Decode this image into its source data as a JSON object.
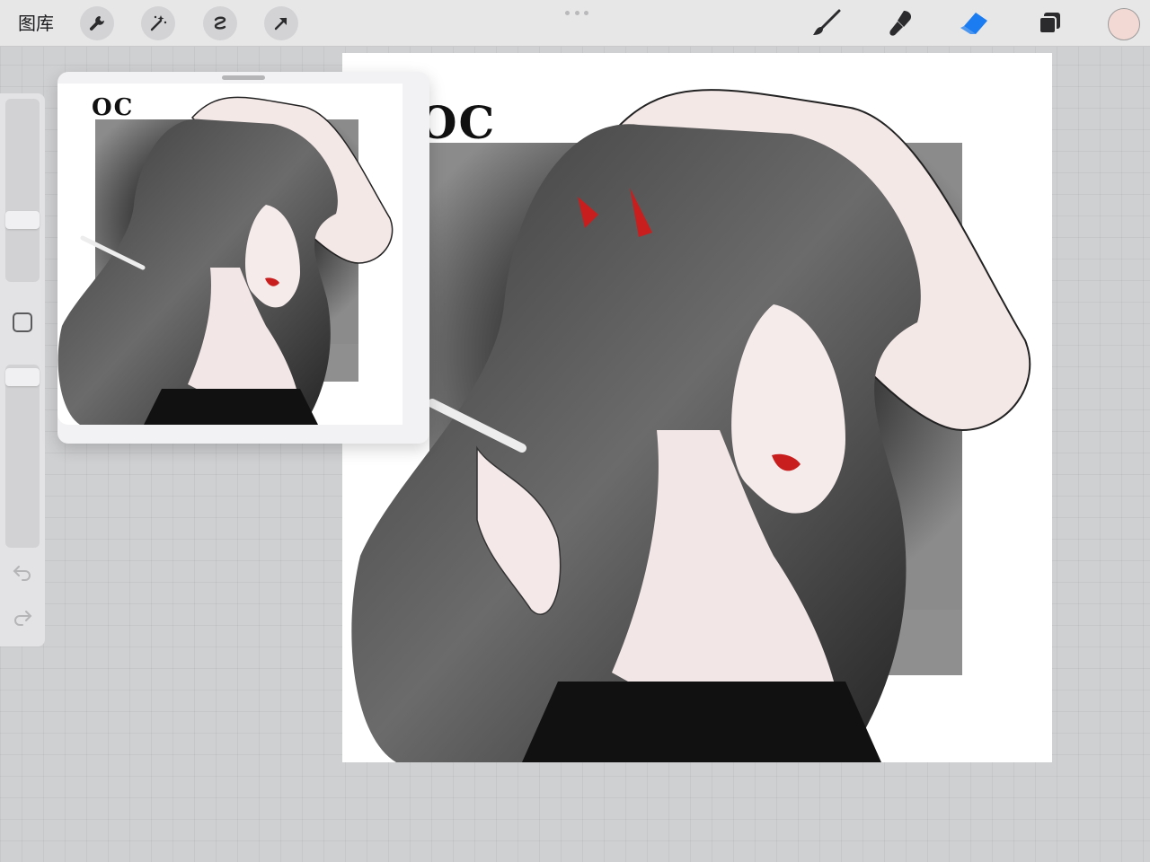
{
  "toolbar": {
    "gallery_label": "图库",
    "left_tools": [
      "wrench-icon",
      "magic-wand-icon",
      "selection-icon",
      "transform-arrow-icon"
    ],
    "right_tools": [
      "brush-icon",
      "smudge-icon",
      "eraser-icon",
      "layers-icon"
    ],
    "active_tool": "eraser",
    "accent_color": "#1a7cf0",
    "current_color": "#f3d9d4"
  },
  "sidebar": {
    "brush_size_level": 0.3,
    "opacity_level": 0.1
  },
  "canvas": {
    "artwork_text": "OC"
  },
  "reference": {
    "artwork_text": "OC"
  }
}
